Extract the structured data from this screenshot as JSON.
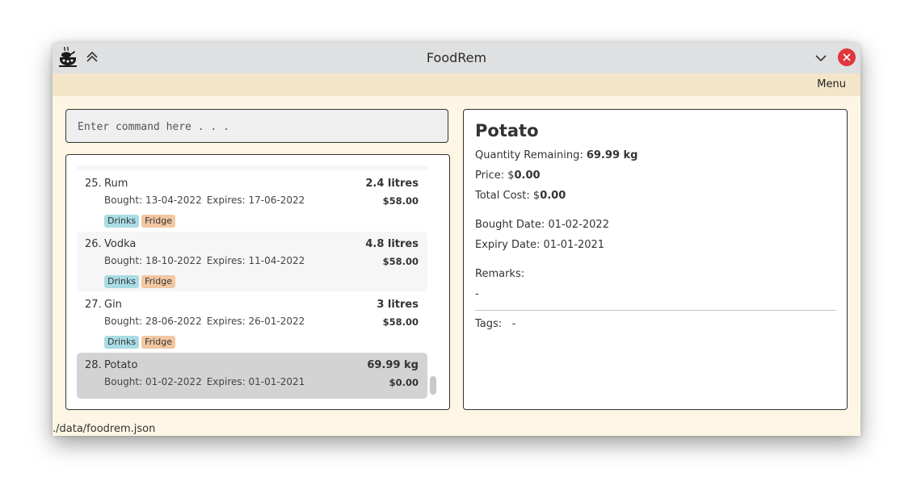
{
  "window": {
    "title": "FoodRem"
  },
  "menu": {
    "label": "Menu"
  },
  "command": {
    "placeholder": "Enter command here . . ."
  },
  "items": [
    {
      "index": "25.",
      "name": "Rum",
      "bought": "Bought: 13-04-2022",
      "expires": "Expires: 17-06-2022",
      "quantity": "2.4 litres",
      "price": "$58.00",
      "tags": [
        "Drinks",
        "Fridge"
      ]
    },
    {
      "index": "26.",
      "name": "Vodka",
      "bought": "Bought: 18-10-2022",
      "expires": "Expires: 11-04-2022",
      "quantity": "4.8 litres",
      "price": "$58.00",
      "tags": [
        "Drinks",
        "Fridge"
      ]
    },
    {
      "index": "27.",
      "name": "Gin",
      "bought": "Bought: 28-06-2022",
      "expires": "Expires: 26-01-2022",
      "quantity": "3 litres",
      "price": "$58.00",
      "tags": [
        "Drinks",
        "Fridge"
      ]
    },
    {
      "index": "28.",
      "name": "Potato",
      "bought": "Bought: 01-02-2022",
      "expires": "Expires: 01-01-2021",
      "quantity": "69.99 kg",
      "price": "$0.00",
      "tags": []
    }
  ],
  "detail": {
    "name": "Potato",
    "quantity_label": "Quantity Remaining:",
    "quantity_value": "69.99 kg",
    "price_label": "Price: $",
    "price_value": "0.00",
    "total_label": "Total Cost: $",
    "total_value": "0.00",
    "bought": "Bought Date: 01-02-2022",
    "expiry": "Expiry Date: 01-01-2021",
    "remarks_label": "Remarks:",
    "remarks_value": "-",
    "tags_label": "Tags:",
    "tags_value": "-"
  },
  "status": {
    "path": "./data/foodrem.json"
  },
  "colors": {
    "titlebar": "#dfe0e1",
    "menubar": "#f3e6c8",
    "background": "#fdf6e4",
    "close": "#e0363d",
    "tag_drinks": "#a9dce4",
    "tag_fridge": "#f2c7a2",
    "selected_row": "#d3d3d3"
  }
}
